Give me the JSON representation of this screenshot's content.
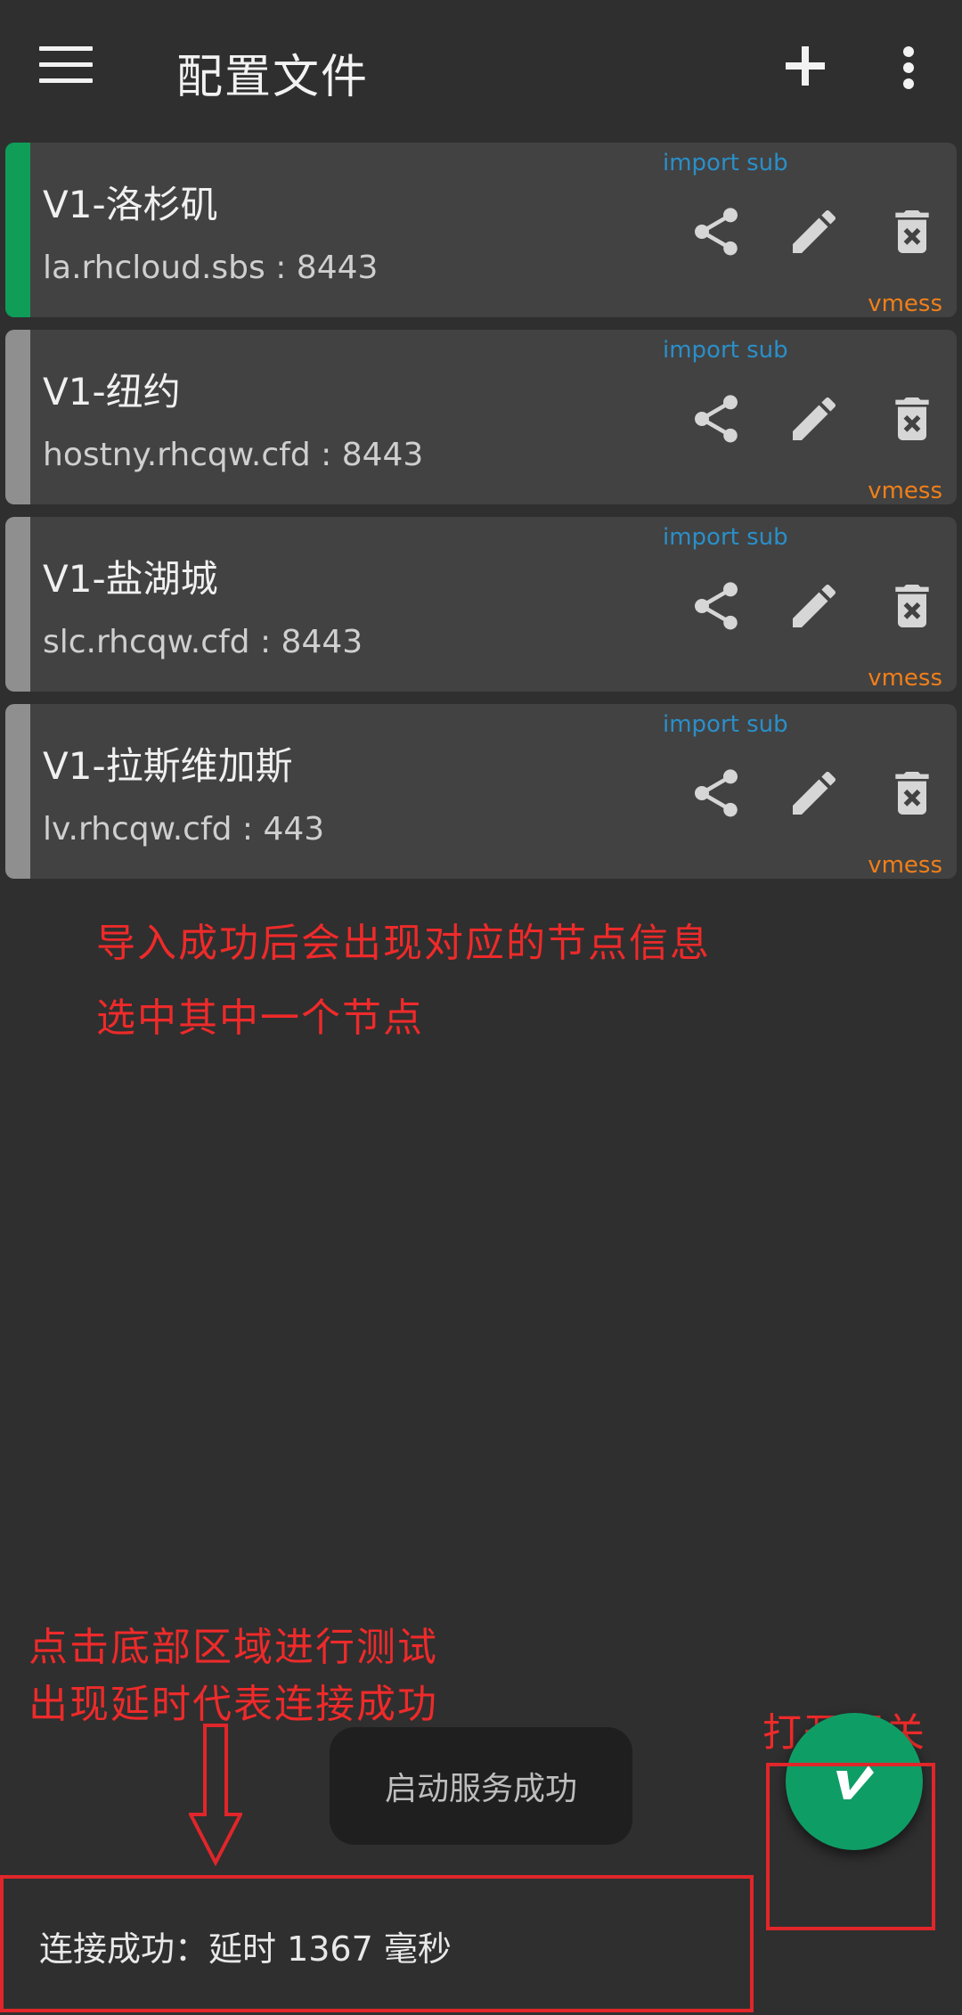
{
  "appbar": {
    "title": "配置文件",
    "menu_icon": "menu-icon",
    "add_icon": "add-icon",
    "more_icon": "more-vert-icon"
  },
  "servers": [
    {
      "name": "V1-洛杉矶",
      "address": "la.rhcloud.sbs : 8443",
      "subscription": "import sub",
      "type": "vmess",
      "selected": true
    },
    {
      "name": "V1-纽约",
      "address": "hostny.rhcqw.cfd : 8443",
      "subscription": "import sub",
      "type": "vmess",
      "selected": false
    },
    {
      "name": "V1-盐湖城",
      "address": "slc.rhcqw.cfd : 8443",
      "subscription": "import sub",
      "type": "vmess",
      "selected": false
    },
    {
      "name": "V1-拉斯维加斯",
      "address": "lv.rhcqw.cfd : 443",
      "subscription": "import sub",
      "type": "vmess",
      "selected": false
    }
  ],
  "annotations": {
    "line1": "导入成功后会出现对应的节点信息",
    "line2": "选中其中一个节点",
    "bottom1": "点击底部区域进行测试",
    "bottom2": "出现延时代表连接成功",
    "switch": "打开开关"
  },
  "toast": "启动服务成功",
  "status": "连接成功：延时 1367 毫秒",
  "colors": {
    "background": "#2f2f2f",
    "card": "#424242",
    "selected_stripe": "#0f9d58",
    "stripe": "#8f8f8f",
    "subscription": "#2a8fc9",
    "type": "#ef7f1a",
    "annotation": "#ee2a2a",
    "fab": "#0f9d66"
  }
}
